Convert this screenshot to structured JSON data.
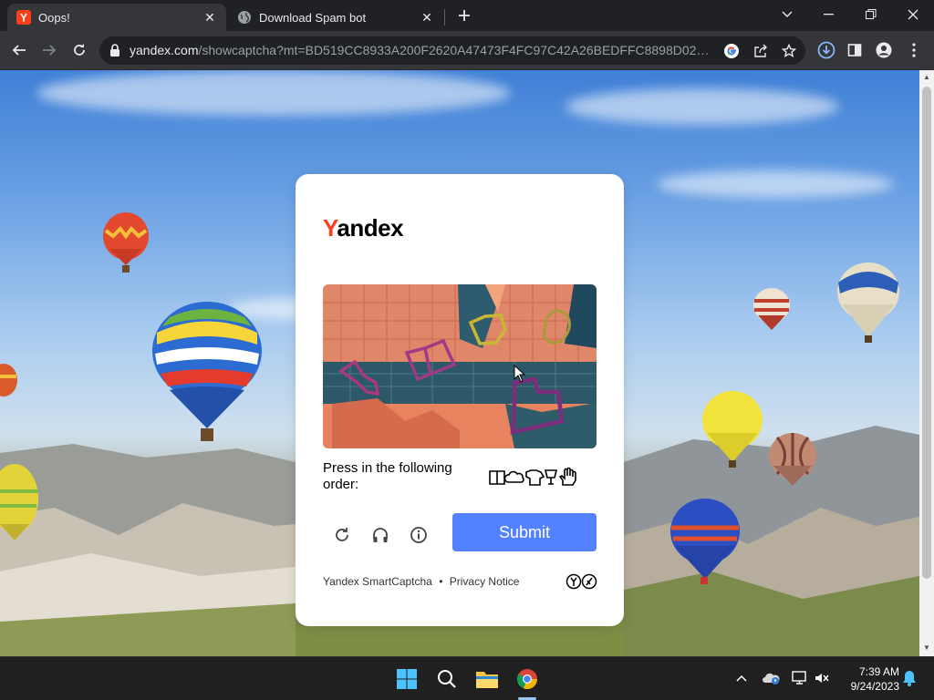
{
  "tabs": [
    {
      "title": "Oops!",
      "favicon": "yandex-y-icon",
      "active": true
    },
    {
      "title": "Download Spam bot",
      "favicon": "globe-icon",
      "active": false
    }
  ],
  "address": {
    "host": "yandex.com",
    "path": "/showcaptcha?mt=BD519CC8933A200F2620A47473F4FC97C42A26BEDFFC8898D02823A6..."
  },
  "captcha": {
    "logo_first": "Y",
    "logo_rest": "andex",
    "prompt": "Press in the following order:",
    "order_icons": [
      "book-icon",
      "cloud-icon",
      "tshirt-icon",
      "cup-icon",
      "hand-icon"
    ],
    "submit_label": "Submit",
    "footer_product": "Yandex SmartCaptcha",
    "footer_sep": "•",
    "footer_privacy": "Privacy Notice",
    "accent": "#5282ff",
    "brand_red": "#fc3f1d"
  },
  "taskbar": {
    "time": "7:39 AM",
    "date": "9/24/2023"
  }
}
